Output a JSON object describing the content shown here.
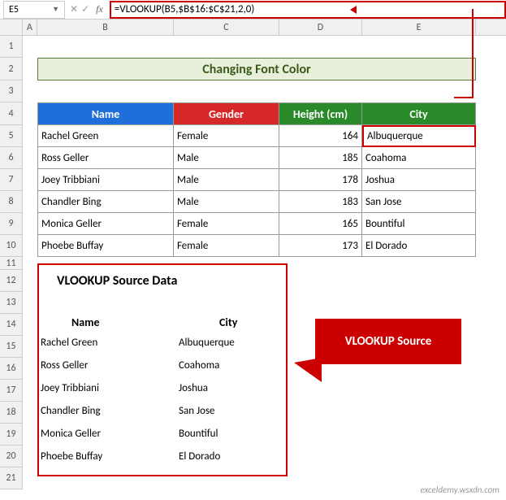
{
  "name_box": "E5",
  "formula": "=VLOOKUP(B5,$B$16:$C$21,2,0)",
  "columns": [
    "A",
    "B",
    "C",
    "D",
    "E"
  ],
  "rows": [
    "1",
    "2",
    "3",
    "4",
    "5",
    "6",
    "7",
    "8",
    "9",
    "10",
    "11",
    "12",
    "13",
    "14",
    "15",
    "16",
    "17",
    "18",
    "19",
    "20",
    "21"
  ],
  "title": "Changing Font Color",
  "headers": {
    "name": "Name",
    "gender": "Gender",
    "height": "Height (cm)",
    "city": "City"
  },
  "table": [
    {
      "name": "Rachel Green",
      "gender": "Female",
      "height": "164",
      "city": "Albuquerque"
    },
    {
      "name": "Ross Geller",
      "gender": "Male",
      "height": "185",
      "city": "Coahoma"
    },
    {
      "name": "Joey Tribbiani",
      "gender": "Male",
      "height": "178",
      "city": "Joshua"
    },
    {
      "name": "Chandler Bing",
      "gender": "Male",
      "height": "183",
      "city": "San Jose"
    },
    {
      "name": "Monica Geller",
      "gender": "Female",
      "height": "165",
      "city": "Bountiful"
    },
    {
      "name": "Phoebe Buffay",
      "gender": "Female",
      "height": "173",
      "city": "El Dorado"
    }
  ],
  "source": {
    "title": "VLOOKUP Source Data",
    "h_name": "Name",
    "h_city": "City",
    "rows": [
      {
        "name": "Rachel Green",
        "city": "Albuquerque"
      },
      {
        "name": "Ross Geller",
        "city": "Coahoma"
      },
      {
        "name": "Joey Tribbiani",
        "city": "Joshua"
      },
      {
        "name": "Chandler Bing",
        "city": "San Jose"
      },
      {
        "name": "Monica Geller",
        "city": "Bountiful"
      },
      {
        "name": "Phoebe Buffay",
        "city": "El Dorado"
      }
    ]
  },
  "callout": "VLOOKUP Source",
  "watermark": "exceldemy.wsxdn.com"
}
